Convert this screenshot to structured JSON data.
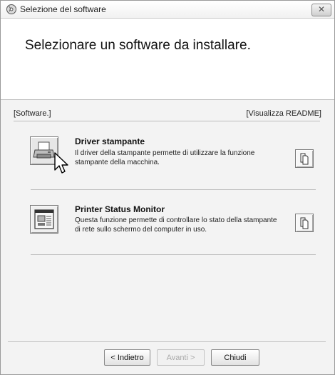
{
  "window": {
    "title": "Selezione del software",
    "close_glyph": "✕"
  },
  "header": {
    "instruction": "Selezionare un software da installare."
  },
  "section": {
    "left_label": "[Software.]",
    "right_label": "[Visualizza README]"
  },
  "items": [
    {
      "title": "Driver stampante",
      "description": "Il driver della stampante permette di utilizzare la funzione stampante della macchina.",
      "icon": "printer-icon",
      "readme_icon": "document-copy-icon"
    },
    {
      "title": "Printer Status Monitor",
      "description": "Questa funzione permette di controllare lo stato della stampante di rete sullo schermo del computer in uso.",
      "icon": "status-monitor-icon",
      "readme_icon": "document-copy-icon"
    }
  ],
  "footer": {
    "back_label": "< Indietro",
    "next_label": "Avanti >",
    "close_label": "Chiudi"
  }
}
